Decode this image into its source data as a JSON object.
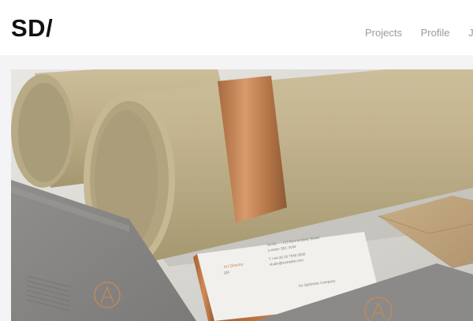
{
  "header": {
    "logo": "SD/",
    "nav": [
      "Projects",
      "Profile",
      "Je"
    ]
  },
  "hero": {
    "card": {
      "lines": [
        "Art Director",
        "S/F",
        "Studio — 213 Bermondsey Street",
        "London SE1 3UW",
        "T +44 (0) 20 7940 0000",
        "studio@example.com",
        "An Optimistic Company"
      ]
    }
  }
}
